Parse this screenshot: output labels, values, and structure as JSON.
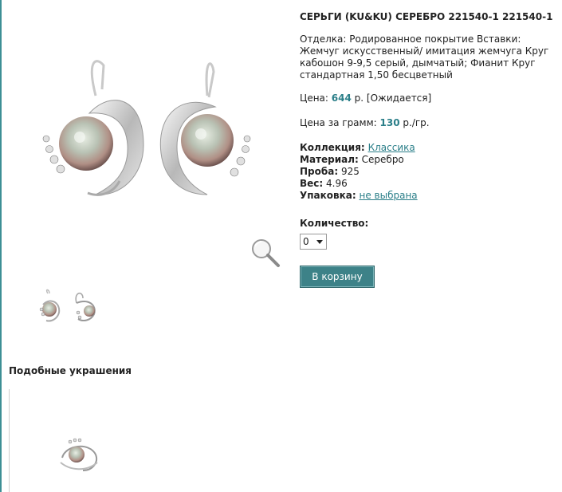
{
  "product": {
    "title": "СЕРЬГИ (KU&KU) СЕРЕБРО 221540-1 221540-1",
    "description": "Отделка: Родированное покрытие Вставки: Жемчуг искусственный/ имитация жемчуга Круг кабошон 9-9,5 серый, дымчатый; Фианит Круг стандартная 1,50 бесцветный",
    "price_label": "Цена:",
    "price_value": "644",
    "price_suffix": "р. [Ожидается]",
    "gram_label": "Цена за грамм:",
    "gram_value": "130",
    "gram_suffix": "р./гр.",
    "collection_label": "Коллекция:",
    "collection_value": "Классика",
    "material_label": "Материал:",
    "material_value": "Серебро",
    "proba_label": "Проба:",
    "proba_value": "925",
    "weight_label": "Вес:",
    "weight_value": "4.96",
    "package_label": "Упаковка:",
    "package_value": "не выбрана",
    "qty_label": "Количество:",
    "qty_value": "0",
    "cart_button": "В корзину"
  },
  "similar": {
    "title": "Подобные украшения"
  },
  "icons": {
    "zoom": "magnifier-icon"
  },
  "colors": {
    "accent": "#2b7f89",
    "button": "#3d8288",
    "left_rule": "#3d8f95"
  }
}
